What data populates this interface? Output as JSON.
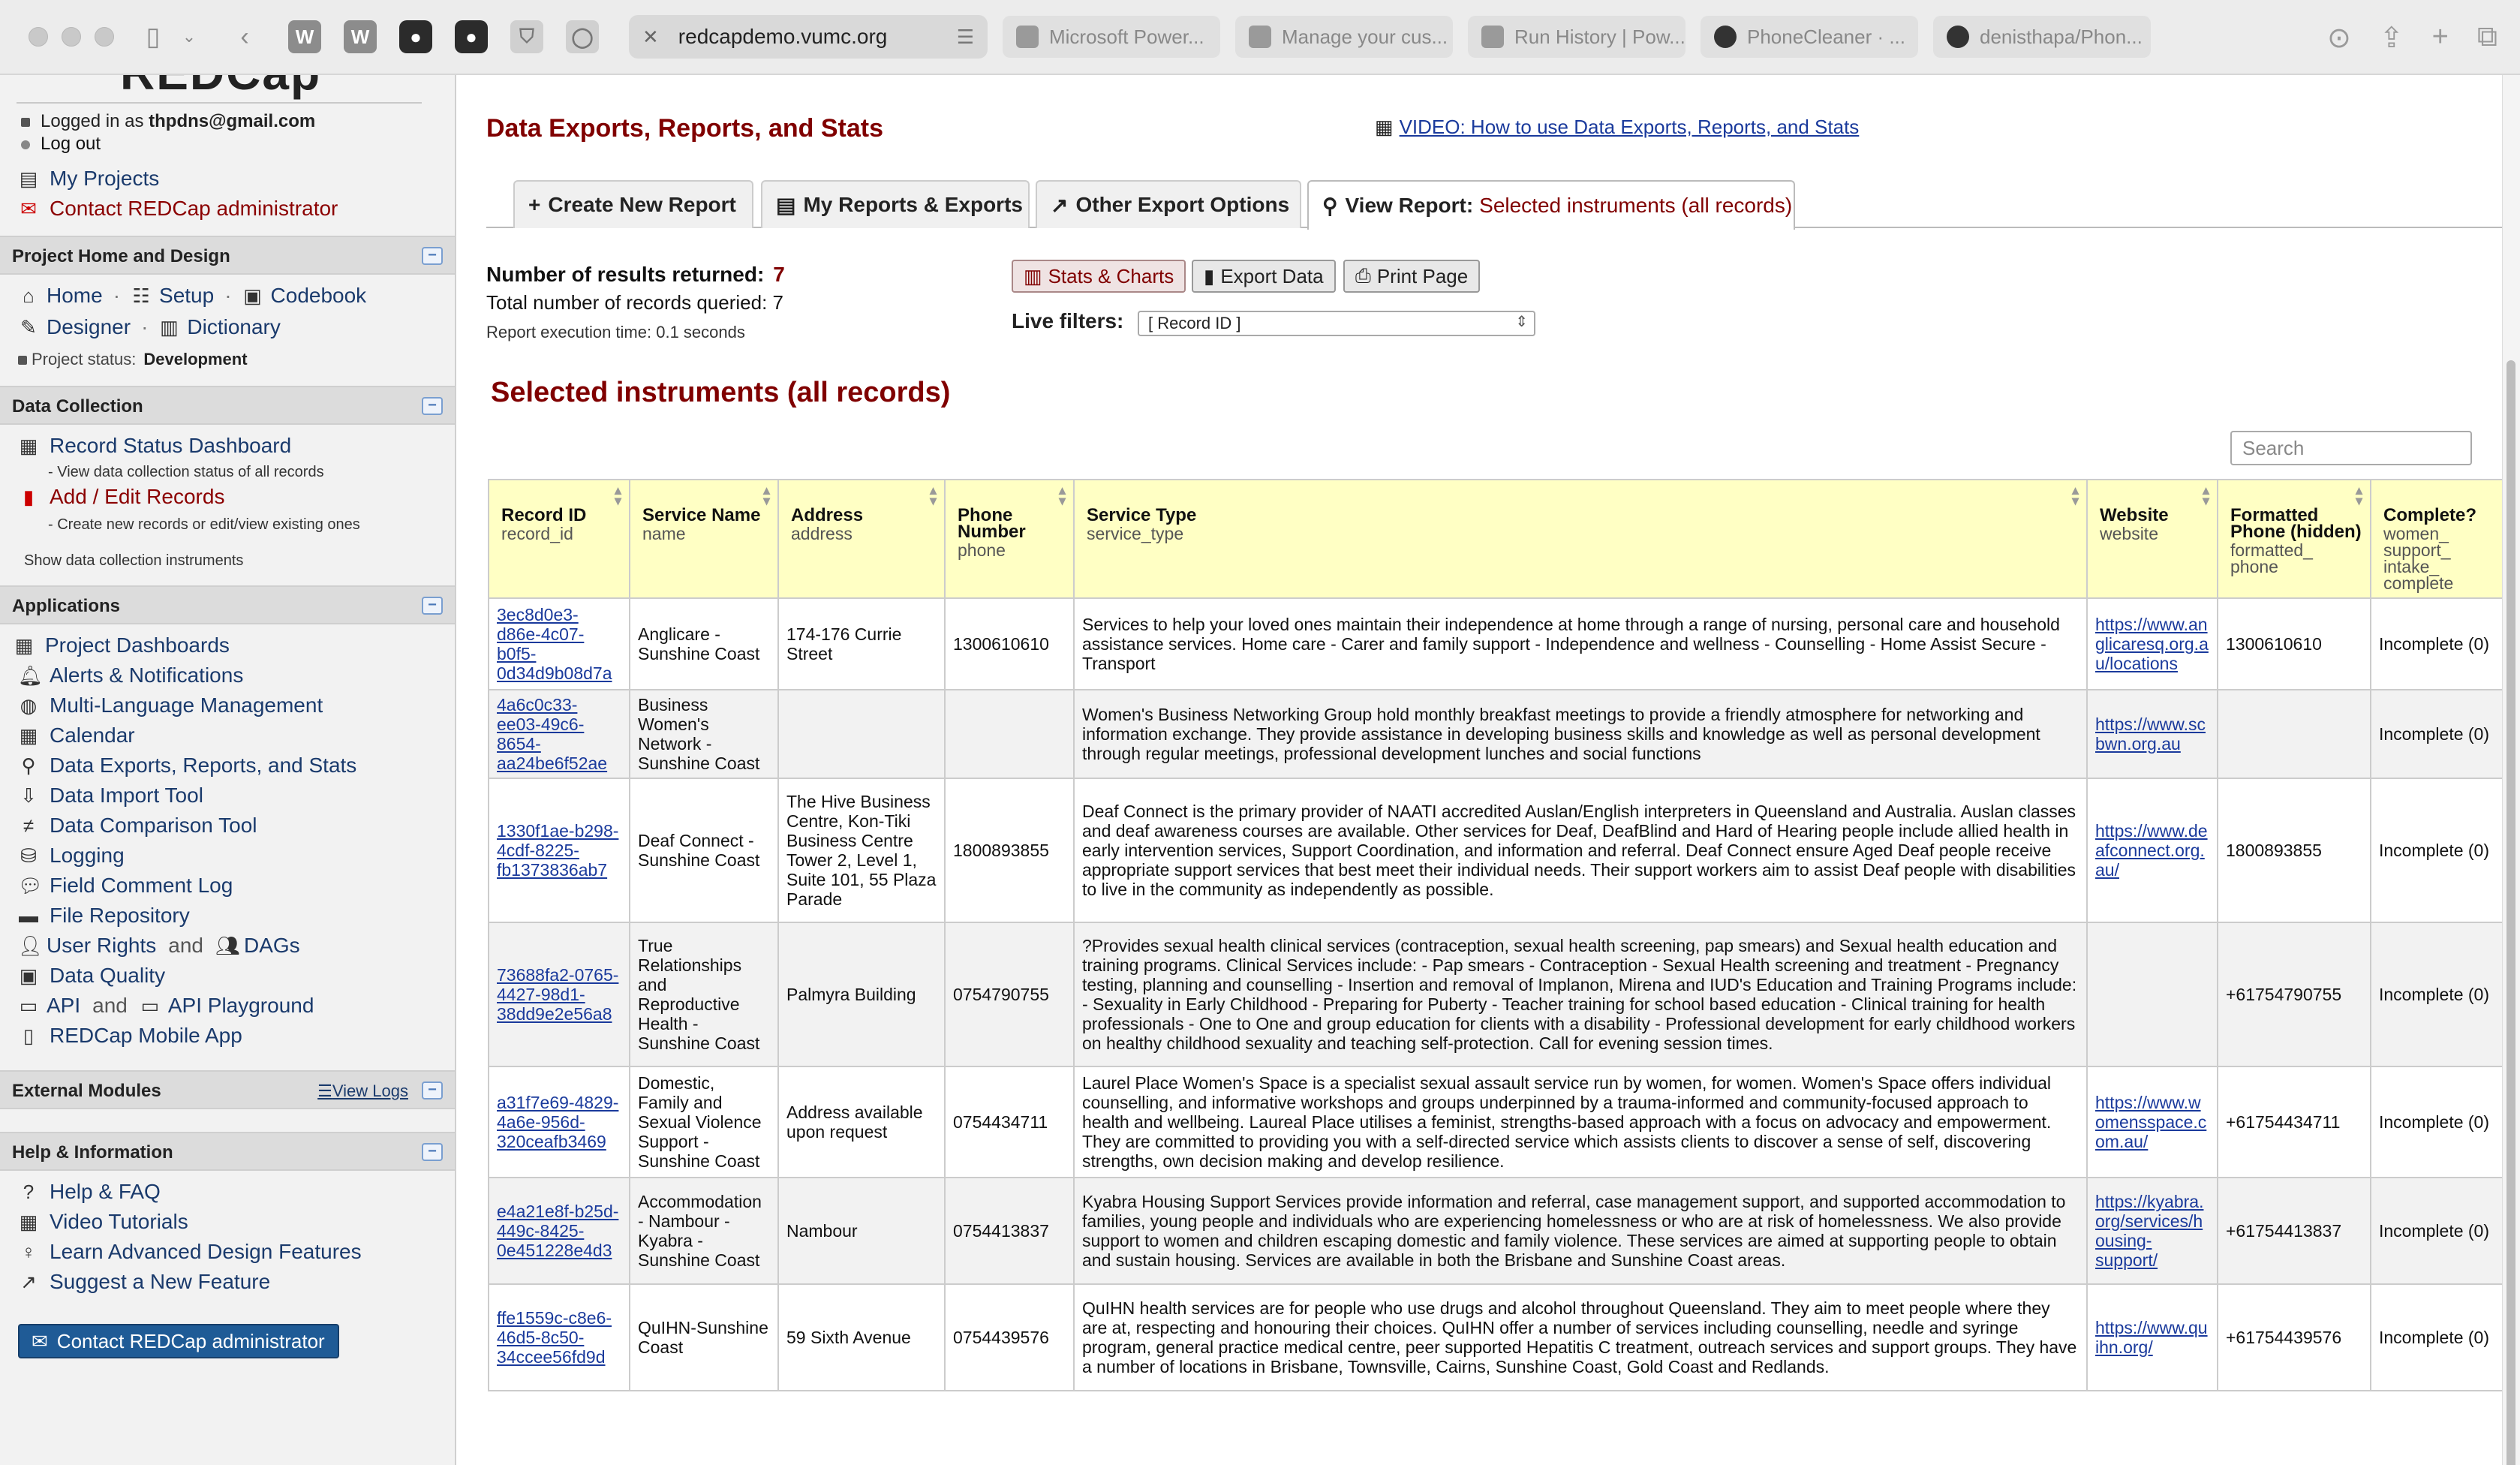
{
  "browser": {
    "url": "redcapdemo.vumc.org",
    "tabs": [
      "Microsoft Power...",
      "Manage your cus...",
      "Run History | Pow...",
      "PhoneCleaner · ...",
      "denisthapa/Phon..."
    ]
  },
  "sidebar": {
    "logo": "REDCap",
    "logged_in_prefix": "Logged in as",
    "user": "thpdns@gmail.com",
    "logout": "Log out",
    "my_projects": "My Projects",
    "contact_admin": "Contact REDCap administrator",
    "project_home": {
      "title": "Project Home and Design",
      "home": "Home",
      "setup": "Setup",
      "codebook": "Codebook",
      "designer": "Designer",
      "dictionary": "Dictionary",
      "status_label": "Project status:",
      "status_value": "Development"
    },
    "data_collection": {
      "title": "Data Collection",
      "record_status": "Record Status Dashboard",
      "record_status_sub": "- View data collection status of all records",
      "add_edit": "Add / Edit Records",
      "add_edit_sub": "- Create new records or edit/view existing ones",
      "show_instruments": "Show data collection instruments"
    },
    "applications": {
      "title": "Applications",
      "items": [
        "Project Dashboards",
        "Alerts & Notifications",
        "Multi-Language Management",
        "Calendar",
        "Data Exports, Reports, and Stats",
        "Data Import Tool",
        "Data Comparison Tool",
        "Logging",
        "Field Comment Log",
        "File Repository"
      ],
      "user_rights": "User Rights",
      "and": "and",
      "dags": "DAGs",
      "data_quality": "Data Quality",
      "api": "API",
      "api_playground": "API Playground",
      "mobile_app": "REDCap Mobile App"
    },
    "external_modules": {
      "title": "External Modules",
      "view_logs": "View Logs"
    },
    "help": {
      "title": "Help & Information",
      "items": [
        "Help & FAQ",
        "Video Tutorials",
        "Learn Advanced Design Features",
        "Suggest a New Feature"
      ],
      "contact_button": "Contact REDCap administrator"
    }
  },
  "main": {
    "title": "Data Exports, Reports, and Stats",
    "video_link": "VIDEO: How to use Data Exports, Reports, and Stats",
    "tabs": {
      "create": "Create New Report",
      "my_reports": "My Reports & Exports",
      "other": "Other Export Options",
      "view_prefix": "View Report:",
      "view_name": "Selected instruments (all records)"
    },
    "results_label": "Number of results returned:",
    "results_count": "7",
    "total_label": "Total number of records queried: 7",
    "exec_time": "Report execution time: 0.1 seconds",
    "buttons": {
      "stats": "Stats & Charts",
      "export": "Export Data",
      "print": "Print Page"
    },
    "live_filters_label": "Live filters:",
    "live_filter_value": "[ Record ID ]",
    "report_title": "Selected instruments (all records)",
    "search_placeholder": "Search"
  },
  "table": {
    "columns": [
      {
        "label": "Record ID",
        "var": "record_id"
      },
      {
        "label": "Service Name",
        "var": "name"
      },
      {
        "label": "Address",
        "var": "address"
      },
      {
        "label": "Phone Number",
        "var": "phone"
      },
      {
        "label": "Service Type",
        "var": "service_type"
      },
      {
        "label": "Website",
        "var": "website"
      },
      {
        "label": "Formatted Phone (hidden)",
        "var": "formatted_ phone"
      },
      {
        "label": "Complete?",
        "var": "women_ support_ intake_ complete"
      }
    ],
    "rows": [
      {
        "record_id": "3ec8d0e3-d86e-4c07-b0f5-0d34d9b08d7a",
        "name": "Anglicare - Sunshine Coast",
        "address": "174-176 Currie Street",
        "phone": "1300610610",
        "service_type": "Services to help your loved ones maintain their independence at home through a range of nursing, personal care and household assistance services. Home care - Carer and family support - Independence and wellness - Counselling - Home Assist Secure - Transport",
        "website": "https://www.anglicaresq.org.au/locations",
        "formatted_phone": "1300610610",
        "complete": "Incomplete (0)"
      },
      {
        "record_id": "4a6c0c33-ee03-49c6-8654-aa24be6f52ae",
        "name": "Business Women's Network - Sunshine Coast",
        "address": "",
        "phone": "",
        "service_type": "Women's Business Networking Group hold monthly breakfast meetings to provide a friendly atmosphere for networking and information exchange. They provide assistance in developing business skills and knowledge as well as personal development through regular meetings, professional development lunches and social functions",
        "website": "https://www.scbwn.org.au",
        "formatted_phone": "",
        "complete": "Incomplete (0)"
      },
      {
        "record_id": "1330f1ae-b298-4cdf-8225-fb1373836ab7",
        "name": "Deaf Connect - Sunshine Coast",
        "address": "The Hive Business Centre, Kon-Tiki Business Centre Tower 2, Level 1, Suite 101, 55 Plaza Parade",
        "phone": "1800893855",
        "service_type": "Deaf Connect is the primary provider of NAATI accredited Auslan/English interpreters in Queensland and Australia. Auslan classes and deaf awareness courses are available. Other services for Deaf, DeafBlind and Hard of Hearing people include allied health in early intervention services, Support Coordination, and information and referral. Deaf Connect ensure Aged Deaf people receive appropriate support services that best meet their individual needs. Their support workers aim to assist Deaf people with disabilities to live in the community as independently as possible.",
        "website": "https://www.deafconnect.org.au/",
        "formatted_phone": "1800893855",
        "complete": "Incomplete (0)"
      },
      {
        "record_id": "73688fa2-0765-4427-98d1-38dd9e2e56a8",
        "name": "True Relationships and Reproductive Health - Sunshine Coast",
        "address": "Palmyra Building",
        "phone": "0754790755",
        "service_type": "?Provides sexual health clinical services (contraception, sexual health screening, pap smears) and Sexual health education and training programs. Clinical Services include: - Pap smears - Contraception - Sexual Health screening and treatment - Pregnancy testing, planning and counselling - Insertion and removal of Implanon, Mirena and IUD's Education and Training Programs include: - Sexuality in Early Childhood - Preparing for Puberty - Teacher training for school based education - Clinical training for health professionals - One to One and group education for clients with a disability - Professional development for early childhood workers on healthy childhood sexuality and teaching self-protection. Call for evening session times.",
        "website": "",
        "formatted_phone": "+61754790755",
        "complete": "Incomplete (0)"
      },
      {
        "record_id": "a31f7e69-4829-4a6e-956d-320ceafb3469",
        "name": "Domestic, Family and Sexual Violence Support - Sunshine Coast",
        "address": "Address available upon request",
        "phone": "0754434711",
        "service_type": "Laurel Place Women's Space is a specialist sexual assault service run by women, for women. Women's Space offers individual counselling, and informative workshops and groups underpinned by a trauma-informed and community-focused approach to health and wellbeing. Laureal Place utilises a feminist, strengths-based approach with a focus on advocacy and empowerment. They are committed to providing you with a self-directed service which assists clients to discover a sense of self, discovering strengths, own decision making and develop resilience.",
        "website": "https://www.womensspace.com.au/",
        "formatted_phone": "+61754434711",
        "complete": "Incomplete (0)"
      },
      {
        "record_id": "e4a21e8f-b25d-449c-8425-0e451228e4d3",
        "name": "Accommodation - Nambour - Kyabra - Sunshine Coast",
        "address": "Nambour",
        "phone": "0754413837",
        "service_type": "Kyabra Housing Support Services provide information and referral, case management support, and supported accommodation to families, young people and individuals who are experiencing homelessness or who are at risk of homelessness. We also provide support to women and children escaping domestic and family violence. These services are aimed at supporting people to obtain and sustain housing. Services are available in both the Brisbane and Sunshine Coast areas.",
        "website": "https://kyabra.org/services/housing-support/",
        "formatted_phone": "+61754413837",
        "complete": "Incomplete (0)"
      },
      {
        "record_id": "ffe1559c-c8e6-46d5-8c50-34ccee56fd9d",
        "name": "QuIHN-Sunshine Coast",
        "address": "59 Sixth Avenue",
        "phone": "0754439576",
        "service_type": "QuIHN health services are for people who use drugs and alcohol throughout Queensland. They aim to meet people where they are at, respecting and honouring their choices. QuIHN offer a number of services including counselling, needle and syringe program, general practice medical centre, peer supported Hepatitis C treatment, outreach services and support groups. They have a number of locations in Brisbane, Townsville, Cairns, Sunshine Coast, Gold Coast and Redlands.",
        "website": "https://www.quihn.org/",
        "formatted_phone": "+61754439576",
        "complete": "Incomplete (0)"
      }
    ]
  }
}
